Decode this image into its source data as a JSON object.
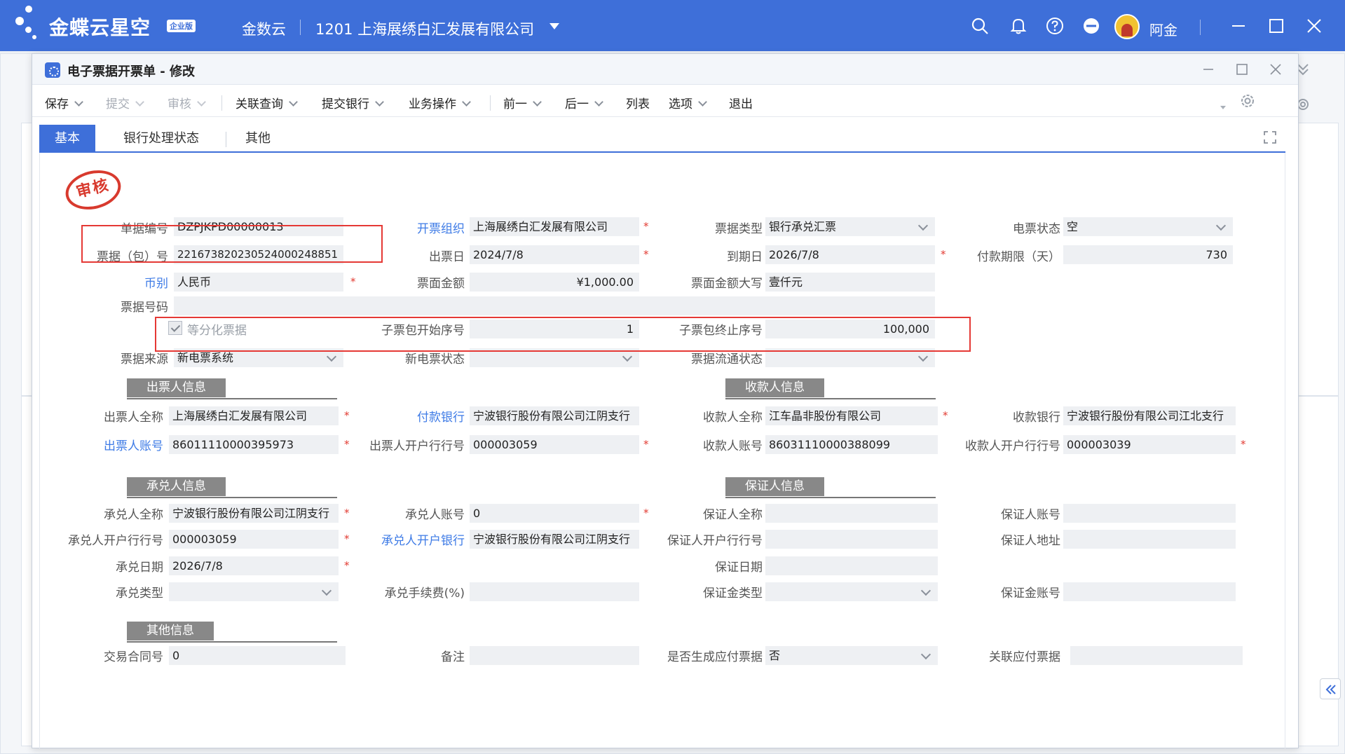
{
  "app": {
    "logo_text": "金蝶云星空",
    "edition_badge": "企业版",
    "brand_secondary": "金数云",
    "company": "1201  上海展绣白汇发展有限公司",
    "user_name": "阿金"
  },
  "window": {
    "title": "电子票据开票单 - 修改"
  },
  "toolbar": {
    "save": "保存",
    "submit": "提交",
    "audit": "审核",
    "related_query": "关联查询",
    "submit_bank": "提交银行",
    "business_ops": "业务操作",
    "prev": "前一",
    "next": "后一",
    "list": "列表",
    "options": "选项",
    "exit": "退出"
  },
  "tabs": {
    "basic": "基本",
    "bank_status": "银行处理状态",
    "other": "其他"
  },
  "stamp_text": "审核",
  "form": {
    "bill_no_label": "单据编号",
    "bill_no": "DZPJKPD00000013",
    "issue_org_label": "开票组织",
    "issue_org": "上海展绣白汇发展有限公司",
    "bill_type_label": "票据类型",
    "bill_type": "银行承兑汇票",
    "e_status_label": "电票状态",
    "e_status": "空",
    "package_no_label": "票据（包）号",
    "package_no": "221673820230524000248851",
    "issue_date_label": "出票日",
    "issue_date": "2024/7/8",
    "due_date_label": "到期日",
    "due_date": "2026/7/8",
    "pay_term_label": "付款期限（天）",
    "pay_term": "730",
    "currency_label": "币别",
    "currency": "人民币",
    "face_amount_label": "票面金额",
    "face_amount": "¥1,000.00",
    "face_amount_cn_label": "票面金额大写",
    "face_amount_cn": "壹仟元",
    "bill_number_label": "票据号码",
    "bill_number": "",
    "split_label": "等分化票据",
    "sub_start_label": "子票包开始序号",
    "sub_start": "1",
    "sub_end_label": "子票包终止序号",
    "sub_end": "100,000",
    "source_label": "票据来源",
    "source": "新电票系统",
    "new_status_label": "新电票状态",
    "new_status": "",
    "flow_status_label": "票据流通状态",
    "flow_status": ""
  },
  "sections": {
    "drawer": "出票人信息",
    "payee": "收款人信息",
    "acceptor": "承兑人信息",
    "guarantor": "保证人信息",
    "other": "其他信息"
  },
  "drawer": {
    "name_label": "出票人全称",
    "name": "上海展绣白汇发展有限公司",
    "pay_bank_label": "付款银行",
    "pay_bank": "宁波银行股份有限公司江阴支行",
    "account_label": "出票人账号",
    "account": "86011110000395973",
    "bank_no_label": "出票人开户行行号",
    "bank_no": "000003059"
  },
  "payee": {
    "name_label": "收款人全称",
    "name": "江车晶非股份有限公司",
    "bank_label": "收款银行",
    "bank": "宁波银行股份有限公司江北支行",
    "account_label": "收款人账号",
    "account": "86031110000388099",
    "bank_no_label": "收款人开户行行号",
    "bank_no": "000003039"
  },
  "acceptor": {
    "name_label": "承兑人全称",
    "name": "宁波银行股份有限公司江阴支行",
    "account_label": "承兑人账号",
    "account": "0",
    "bank_no_label": "承兑人开户行行号",
    "bank_no": "000003059",
    "bank_label": "承兑人开户银行",
    "bank": "宁波银行股份有限公司江阴支行",
    "date_label": "承兑日期",
    "date": "2026/7/8",
    "type_label": "承兑类型",
    "type": "",
    "fee_label": "承兑手续费(%)",
    "fee": ""
  },
  "guarantor": {
    "name_label": "保证人全称",
    "name": "",
    "account_label": "保证人账号",
    "account": "",
    "bank_no_label": "保证人开户行行号",
    "bank_no": "",
    "address_label": "保证人地址",
    "address": "",
    "date_label": "保证日期",
    "date": "",
    "deposit_type_label": "保证金类型",
    "deposit_type": "",
    "deposit_account_label": "保证金账号",
    "deposit_account": ""
  },
  "other": {
    "contract_label": "交易合同号",
    "contract": "0",
    "remark_label": "备注",
    "remark": "",
    "gen_payable_label": "是否生成应付票据",
    "gen_payable": "否",
    "linked_payable_label": "关联应付票据",
    "linked_payable": ""
  },
  "colors": {
    "brand": "#3e6fd9",
    "required": "#e23b32",
    "highlight_box": "#e53935",
    "stamp": "#d83a2e"
  }
}
